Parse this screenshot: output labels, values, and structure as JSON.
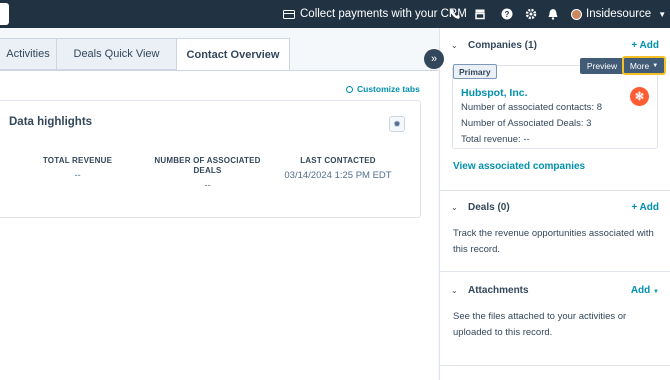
{
  "topbar": {
    "pay_label": "Collect payments with your CRM",
    "account_name": "Insidesource"
  },
  "tabs": [
    {
      "label": "Activities"
    },
    {
      "label": "Deals Quick View"
    },
    {
      "label": "Contact Overview"
    }
  ],
  "customize_tabs": "Customize tabs",
  "highlights": {
    "title": "Data highlights",
    "metrics": [
      {
        "label": "TOTAL REVENUE",
        "value": "--"
      },
      {
        "label": "NUMBER OF ASSOCIATED DEALS",
        "value": "--"
      },
      {
        "label": "LAST CONTACTED",
        "value": "03/14/2024 1:25 PM EDT"
      }
    ]
  },
  "sidebar": {
    "companies": {
      "title": "Companies (1)",
      "add_label": "+ Add",
      "primary_badge": "Primary",
      "preview_label": "Preview",
      "more_label": "More",
      "company": {
        "name": "Hubspot, Inc.",
        "contacts": "Number of associated contacts:  8",
        "deals": "Number of Associated Deals:  3",
        "revenue": "Total revenue:  --"
      },
      "view_link": "View associated companies"
    },
    "deals": {
      "title": "Deals (0)",
      "add_label": "+ Add",
      "description": "Track the revenue opportunities associated with this record."
    },
    "attachments": {
      "title": "Attachments",
      "add_label": "Add",
      "description": "See the files attached to your activities or uploaded to this record."
    }
  }
}
